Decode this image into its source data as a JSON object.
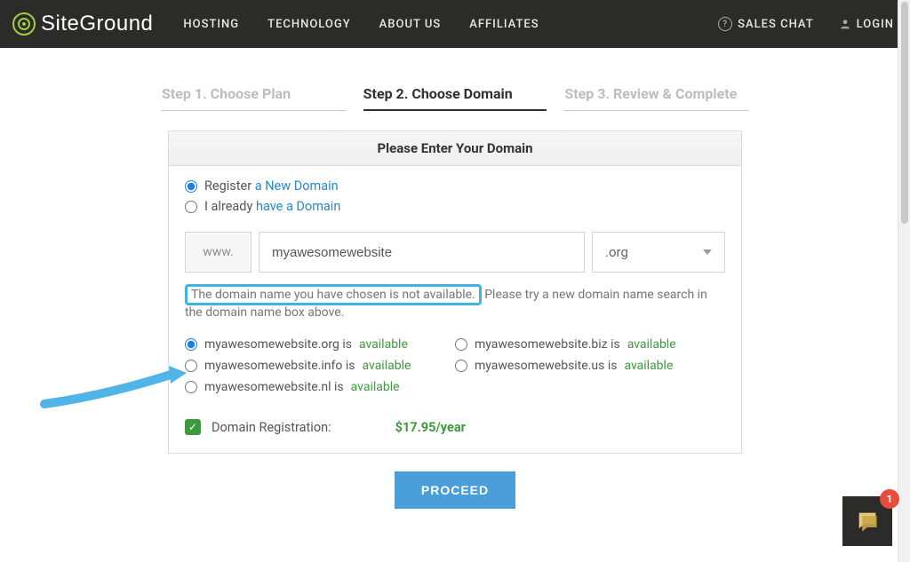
{
  "brand": "SiteGround",
  "nav": {
    "hosting": "HOSTING",
    "technology": "TECHNOLOGY",
    "about": "ABOUT US",
    "affiliates": "AFFILIATES"
  },
  "top_right": {
    "sales_chat": "SALES CHAT",
    "login": "LOGIN"
  },
  "steps": {
    "s1": "Step 1. Choose Plan",
    "s2": "Step 2. Choose Domain",
    "s3": "Step 3. Review & Complete"
  },
  "panel_title": "Please Enter Your Domain",
  "options": {
    "register_prefix": "Register ",
    "register_link": "a New Domain",
    "have_prefix": "I already ",
    "have_link": "have a Domain"
  },
  "domain": {
    "prefix": "www.",
    "value": "myawesomewebsite",
    "tld": ".org"
  },
  "message": {
    "highlight": "The domain name you have chosen is not available.",
    "rest": " Please try a new domain name search in the domain name box above."
  },
  "suggestions": [
    {
      "text": "myawesomewebsite.org is ",
      "status": "available",
      "selected": true
    },
    {
      "text": "myawesomewebsite.biz is ",
      "status": "available",
      "selected": false
    },
    {
      "text": "myawesomewebsite.info is ",
      "status": "available",
      "selected": false
    },
    {
      "text": "myawesomewebsite.us is ",
      "status": "available",
      "selected": false
    },
    {
      "text": "myawesomewebsite.nl is ",
      "status": "available",
      "selected": false
    }
  ],
  "registration": {
    "label": "Domain Registration:",
    "price": "$17.95/year"
  },
  "proceed": "PROCEED",
  "chat_badge": "1"
}
